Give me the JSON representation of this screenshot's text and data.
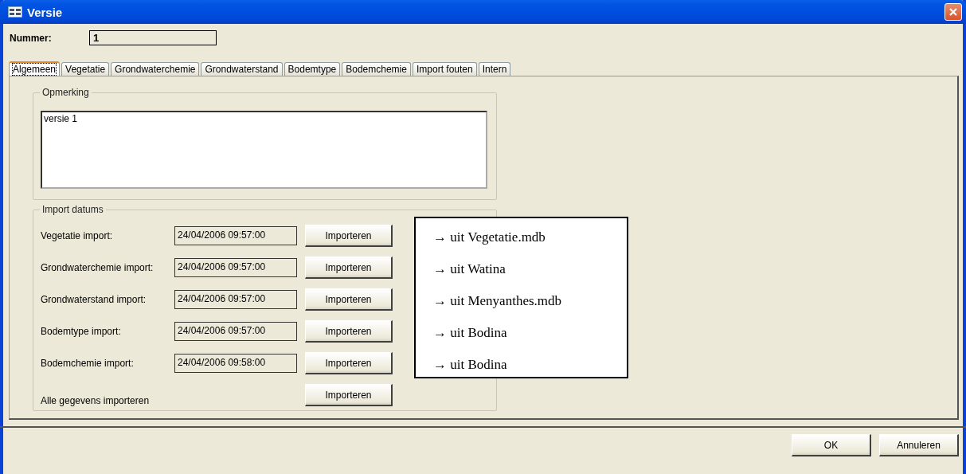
{
  "window": {
    "title": "Versie"
  },
  "number": {
    "label": "Nummer:",
    "value": "1"
  },
  "tabs": [
    {
      "label": "Algemeen",
      "selected": true
    },
    {
      "label": "Vegetatie",
      "selected": false
    },
    {
      "label": "Grondwaterchemie",
      "selected": false
    },
    {
      "label": "Grondwaterstand",
      "selected": false
    },
    {
      "label": "Bodemtype",
      "selected": false
    },
    {
      "label": "Bodemchemie",
      "selected": false
    },
    {
      "label": "Import fouten",
      "selected": false
    },
    {
      "label": "Intern",
      "selected": false
    }
  ],
  "remark_group": {
    "title": "Opmerking",
    "value": "versie 1"
  },
  "import_group": {
    "title": "Import datums",
    "rows": [
      {
        "label": "Vegetatie import:",
        "value": "24/04/2006 09:57:00",
        "button": "Importeren"
      },
      {
        "label": "Grondwaterchemie import:",
        "value": "24/04/2006 09:57:00",
        "button": "Importeren"
      },
      {
        "label": "Grondwaterstand import:",
        "value": "24/04/2006 09:57:00",
        "button": "Importeren"
      },
      {
        "label": "Bodemtype import:",
        "value": "24/04/2006 09:57:00",
        "button": "Importeren"
      },
      {
        "label": "Bodemchemie import:",
        "value": "24/04/2006 09:58:00",
        "button": "Importeren"
      },
      {
        "label": "Alle gegevens importeren",
        "button": "Importeren"
      }
    ]
  },
  "callout": {
    "items": [
      "→ uit Vegetatie.mdb",
      "→ uit Watina",
      "→ uit Menyanthes.mdb",
      "→ uit Bodina",
      "→ uit Bodina"
    ]
  },
  "buttons": [
    "OK",
    "Annuleren"
  ]
}
